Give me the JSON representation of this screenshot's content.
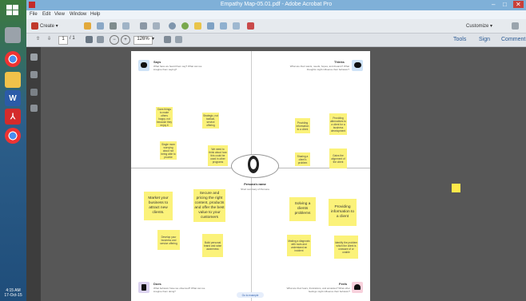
{
  "window": {
    "title": "Empathy Map-05.01.pdf - Adobe Acrobat Pro",
    "controls": [
      "–",
      "□",
      "✕"
    ]
  },
  "menu": [
    "File",
    "Edit",
    "View",
    "Window",
    "Help"
  ],
  "toolbar": {
    "create_label": "Create",
    "customize_label": "Customize"
  },
  "nav": {
    "page_current": "1",
    "page_total": "/ 1",
    "zoom": "126%"
  },
  "panels": [
    "Tools",
    "Sign",
    "Comment"
  ],
  "document": {
    "center_title": "Persona's name",
    "center_sub": "Short summary of Persona",
    "footer_link": "Go to example",
    "corners": [
      {
        "title": "Says",
        "sub": "What have we heard them say? What can we imagine them saying?",
        "color": "#cfe3f7",
        "icon": "speech-bubble-icon"
      },
      {
        "title": "Thinks",
        "sub": "What are their wants, needs, hopes, and dreams? What thoughts might influence their behavior?",
        "color": "#cfe3f7",
        "icon": "thought-cloud-icon"
      },
      {
        "title": "Does",
        "sub": "What behavior have we observed? What can we imagine them doing?",
        "color": "#dcd3f0",
        "icon": "hand-icon"
      },
      {
        "title": "Feels",
        "sub": "What are their fears, frustrations, and anxieties? What other feelings might influence their behavior?",
        "color": "#f8d1dc",
        "icon": "heart-icon"
      }
    ],
    "stickies": [
      {
        "text": "Does things to make others happy, not because they enjoy it",
        "big": false
      },
      {
        "text": "Strategic, not tactical, service offering",
        "big": false
      },
      {
        "text": "Single mom worrying about not being able to provide",
        "big": false
      },
      {
        "text": "We need to think about how this could be used in other programs",
        "big": false
      },
      {
        "text": "Providing information to a client",
        "big": false
      },
      {
        "text": "Providing alternatives to a client for a business development",
        "big": false
      },
      {
        "text": "Sharing a client's problem",
        "big": false
      },
      {
        "text": "Gains the alignment of the client",
        "big": false
      },
      {
        "text": "Market your business to attract new clients.",
        "big": true
      },
      {
        "text": "Secure and pricing the right content, products and offer the best value to your customers",
        "big": true
      },
      {
        "text": "Solving a clients problems",
        "big": true
      },
      {
        "text": "Providing information to a client",
        "big": true
      },
      {
        "text": "Develop your business and service offering",
        "big": false
      },
      {
        "text": "Build personal brand and raise awareness",
        "big": false
      },
      {
        "text": "Making a diagnosis with tools and understand an incident",
        "big": false
      },
      {
        "text": "Identify the problem which the client is unaware of or unable",
        "big": false
      }
    ]
  },
  "taskbar": {
    "time": "4:15 AM",
    "date": "17-Oct-15"
  }
}
